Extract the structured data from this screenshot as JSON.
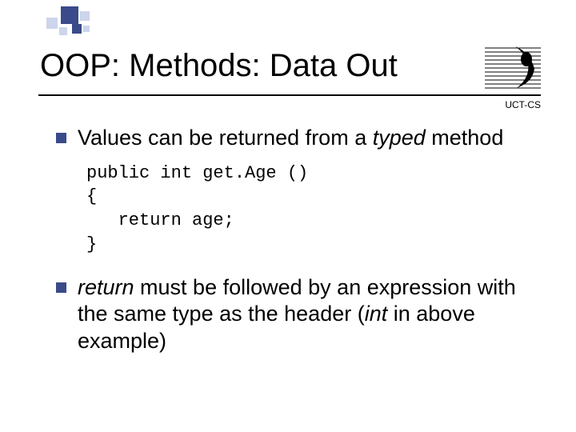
{
  "slide": {
    "title": "OOP: Methods: Data Out",
    "logo_label": "UCT-CS",
    "bullets": [
      {
        "pre": "Values can be returned from a ",
        "em": "typed",
        "post": " method"
      },
      {
        "em1": "return",
        "mid": " must be followed by an expression with the same type as the header (",
        "em2": "int",
        "post": " in above example)"
      }
    ],
    "code": {
      "l1": "public int get.Age ()",
      "l2": "{",
      "l3": "   return age;",
      "l4": "}"
    }
  }
}
